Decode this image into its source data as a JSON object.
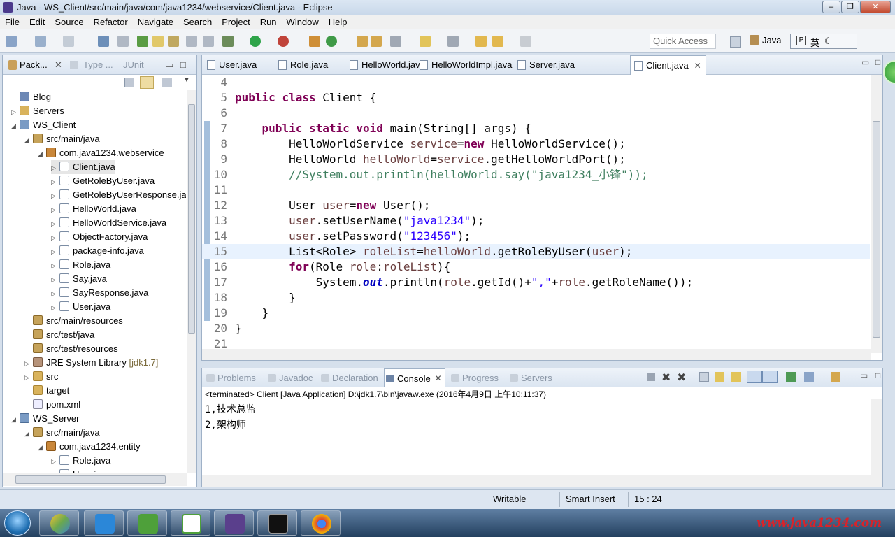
{
  "window": {
    "title": "Java - WS_Client/src/main/java/com/java1234/webservice/Client.java - Eclipse"
  },
  "menu": [
    "File",
    "Edit",
    "Source",
    "Refactor",
    "Navigate",
    "Search",
    "Project",
    "Run",
    "Window",
    "Help"
  ],
  "toolbar": {
    "quick_access_placeholder": "Quick Access",
    "perspective": "Java",
    "ime": "英"
  },
  "explorer": {
    "tabs": {
      "package": "Pack...",
      "type": "Type ...",
      "junit": "JUnit"
    },
    "tree": [
      {
        "label": "Blog",
        "icon": "blog"
      },
      {
        "label": "Servers",
        "icon": "folder"
      },
      {
        "label": "WS_Client",
        "icon": "project"
      },
      {
        "label": "src/main/java",
        "icon": "src"
      },
      {
        "label": "com.java1234.webservice",
        "icon": "package"
      },
      {
        "label": "Client.java",
        "icon": "java"
      },
      {
        "label": "GetRoleByUser.java",
        "icon": "java"
      },
      {
        "label": "GetRoleByUserResponse.java",
        "icon": "java"
      },
      {
        "label": "HelloWorld.java",
        "icon": "java"
      },
      {
        "label": "HelloWorldService.java",
        "icon": "java"
      },
      {
        "label": "ObjectFactory.java",
        "icon": "java"
      },
      {
        "label": "package-info.java",
        "icon": "java"
      },
      {
        "label": "Role.java",
        "icon": "java"
      },
      {
        "label": "Say.java",
        "icon": "java"
      },
      {
        "label": "SayResponse.java",
        "icon": "java"
      },
      {
        "label": "User.java",
        "icon": "java"
      },
      {
        "label": "src/main/resources",
        "icon": "src"
      },
      {
        "label": "src/test/java",
        "icon": "src"
      },
      {
        "label": "src/test/resources",
        "icon": "src"
      },
      {
        "label": "JRE System Library",
        "icon": "library",
        "suffix": "[jdk1.7]"
      },
      {
        "label": "src",
        "icon": "folder"
      },
      {
        "label": "target",
        "icon": "folder"
      },
      {
        "label": "pom.xml",
        "icon": "file"
      },
      {
        "label": "WS_Server",
        "icon": "project"
      },
      {
        "label": "src/main/java",
        "icon": "src"
      },
      {
        "label": "com.java1234.entity",
        "icon": "package"
      },
      {
        "label": "Role.java",
        "icon": "java"
      },
      {
        "label": "User.java",
        "icon": "java"
      }
    ]
  },
  "editor": {
    "tabs": [
      "User.java",
      "Role.java",
      "HelloWorld.java",
      "HelloWorldImpl.java",
      "Server.java",
      "Client.java"
    ],
    "active_tab": "Client.java",
    "lines": [
      {
        "n": "4",
        "code": ""
      },
      {
        "n": "5",
        "code": "public class Client {"
      },
      {
        "n": "6",
        "code": ""
      },
      {
        "n": "7",
        "code": "    public static void main(String[] args) {"
      },
      {
        "n": "8",
        "code": "        HelloWorldService service=new HelloWorldService();"
      },
      {
        "n": "9",
        "code": "        HelloWorld helloWorld=service.getHelloWorldPort();"
      },
      {
        "n": "10",
        "code": "        //System.out.println(helloWorld.say(\"java1234_小锋\"));"
      },
      {
        "n": "11",
        "code": ""
      },
      {
        "n": "12",
        "code": "        User user=new User();"
      },
      {
        "n": "13",
        "code": "        user.setUserName(\"java1234\");"
      },
      {
        "n": "14",
        "code": "        user.setPassword(\"123456\");"
      },
      {
        "n": "15",
        "code": "        List<Role> roleList=helloWorld.getRoleByUser(user);"
      },
      {
        "n": "16",
        "code": "        for(Role role:roleList){"
      },
      {
        "n": "17",
        "code": "            System.out.println(role.getId()+\",\"+role.getRoleName());"
      },
      {
        "n": "18",
        "code": "        }"
      },
      {
        "n": "19",
        "code": "    }"
      },
      {
        "n": "20",
        "code": "}"
      },
      {
        "n": "21",
        "code": ""
      }
    ]
  },
  "console": {
    "tabs": [
      "Problems",
      "Javadoc",
      "Declaration",
      "Console",
      "Progress",
      "Servers"
    ],
    "active_tab": "Console",
    "status": "<terminated> Client [Java Application] D:\\jdk1.7\\bin\\javaw.exe (2016年4月9日 上午10:11:37)",
    "output": [
      "1,技术总监",
      "2,架构师"
    ]
  },
  "statusbar": {
    "mode": "Writable",
    "insert": "Smart Insert",
    "position": "15 : 24"
  },
  "taskbar": {
    "watermark": "www.java1234.com"
  }
}
